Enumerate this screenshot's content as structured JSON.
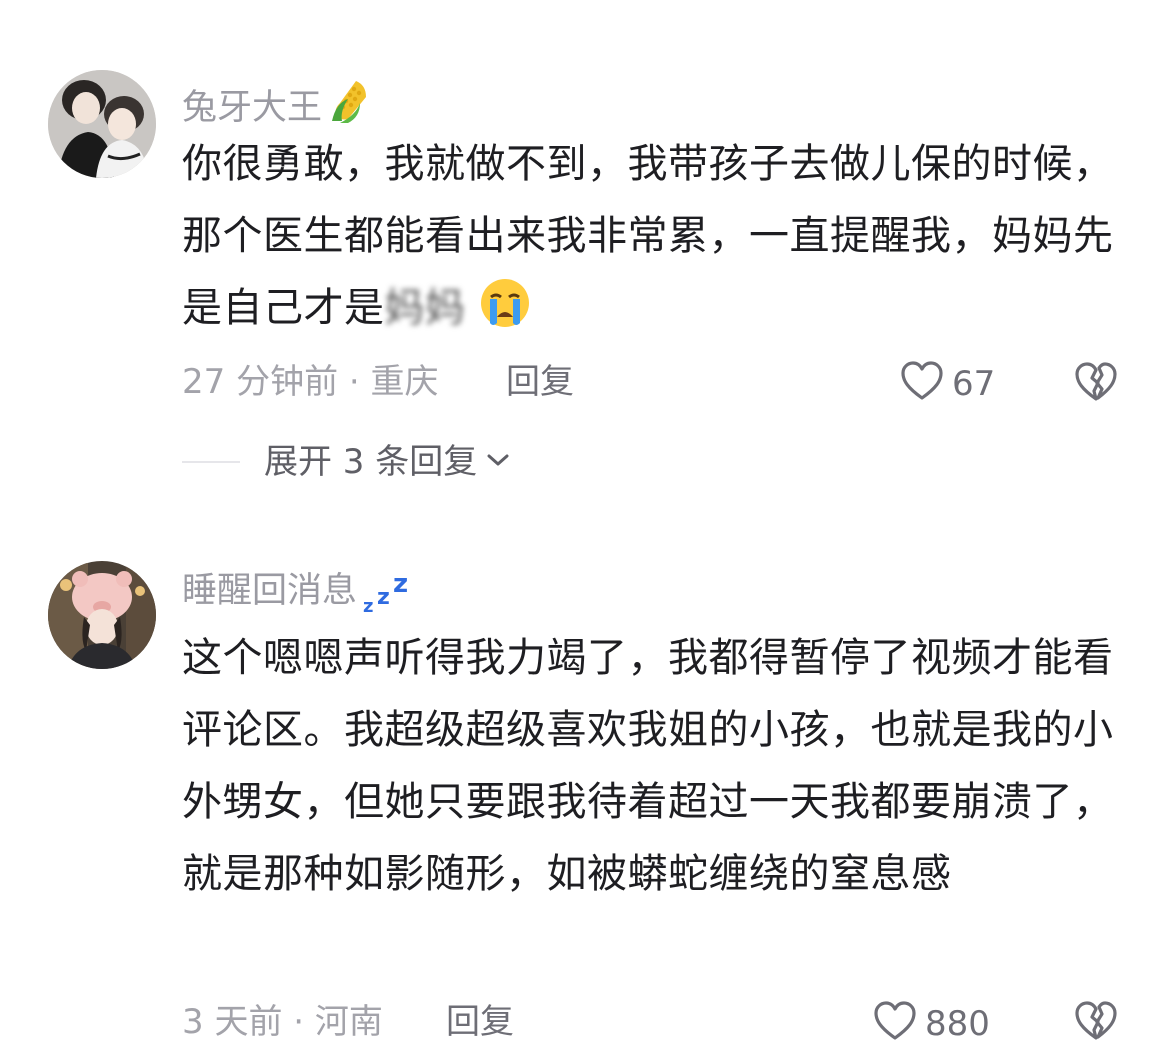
{
  "comments": [
    {
      "username": "兔牙大王",
      "username_icon": "corn-icon",
      "text": "你很勇敢，我就做不到，我带孩子去做儿保的时候，那个医生都能看出来我非常累，一直提醒我，妈妈先是自己才是",
      "text_blurred": "妈妈",
      "text_emoji": "crying-face-icon",
      "meta": "27 分钟前 · 重庆",
      "reply_label": "回复",
      "like_count": "67",
      "expand_label": "展开 3 条回复"
    },
    {
      "username": "睡醒回消息",
      "username_icon": "zzz-icon",
      "text": "这个嗯嗯声听得我力竭了，我都得暂停了视频才能看评论区。我超级超级喜欢我姐的小孩，也就是我的小外甥女，但她只要跟我待着超过一天我都要崩溃了，就是那种如影随形，如被蟒蛇缠绕的窒息感",
      "meta": "3 天前 · 河南",
      "reply_label": "回复",
      "like_count": "880"
    }
  ],
  "colors": {
    "username": "#9a9aa2",
    "body": "#1e1e22",
    "meta": "#a3a3aa",
    "action": "#6e6e76",
    "zzz": "#2f6be0"
  }
}
